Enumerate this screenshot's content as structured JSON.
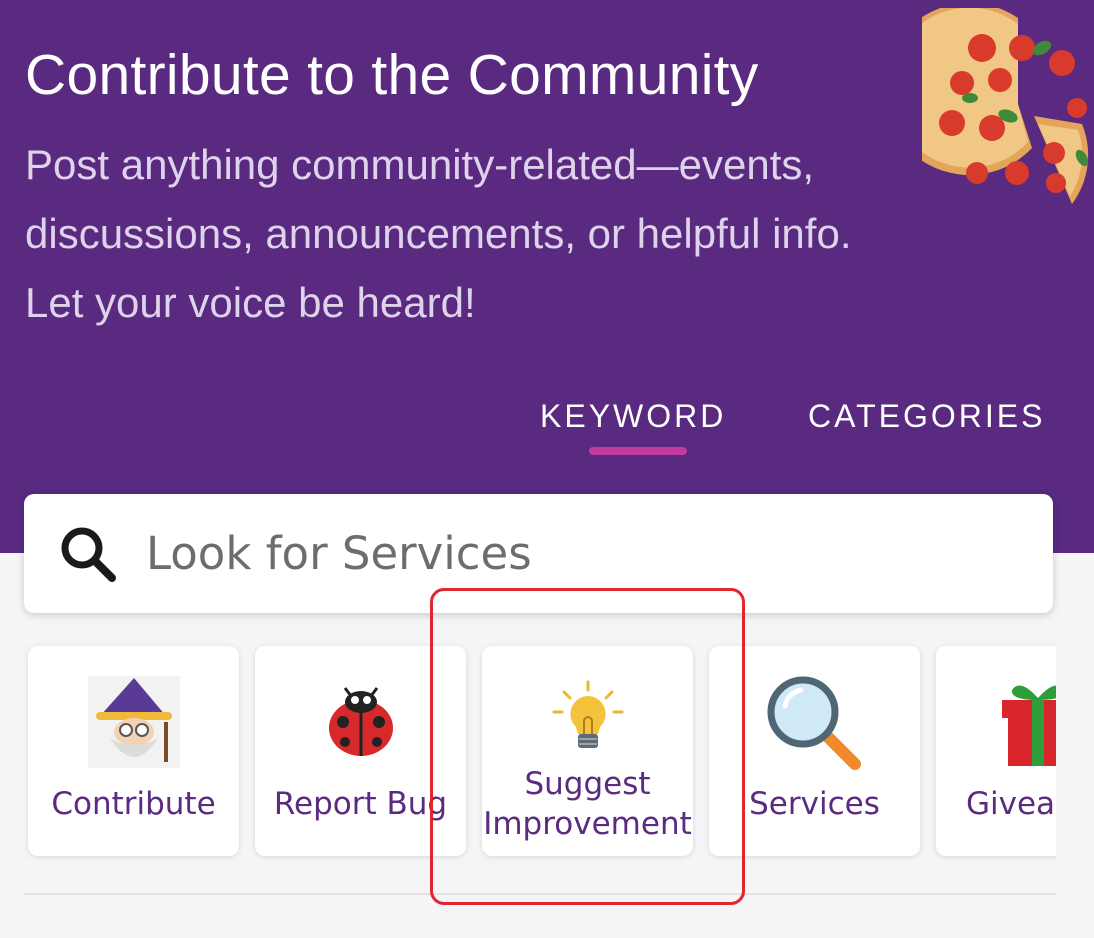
{
  "header": {
    "title": "Contribute to the Community",
    "subtitle": "Post anything community-related—events, discussions, announcements, or helpful info. Let your voice be heard!",
    "decoration_icon": "pizza-icon"
  },
  "tabs": [
    {
      "label": "KEYWORD",
      "active": true
    },
    {
      "label": "CATEGORIES",
      "active": false
    }
  ],
  "search": {
    "placeholder": "Look for Services",
    "icon": "search-icon"
  },
  "categories": [
    {
      "label": "Contribute",
      "icon": "wizard-icon"
    },
    {
      "label": "Report Bug",
      "icon": "ladybug-icon"
    },
    {
      "label": "Suggest\nImprovement",
      "icon": "lightbulb-icon"
    },
    {
      "label": "Services",
      "icon": "magnifier-icon"
    },
    {
      "label": "Giveaway",
      "icon": "gift-icon"
    }
  ],
  "colors": {
    "header_bg": "#592a80",
    "accent": "#c23b9f",
    "label_purple": "#5a2b80",
    "highlight_red": "#e0262e"
  }
}
